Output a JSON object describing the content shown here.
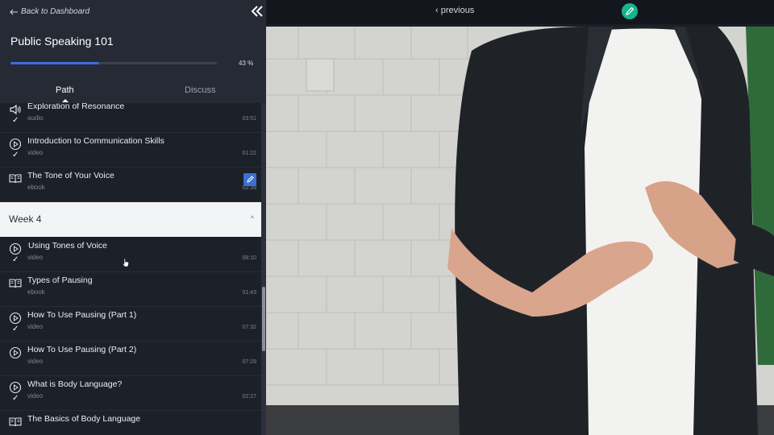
{
  "nav": {
    "back_label": "Back to Dashboard",
    "collapse_icon": "double-chevron-left-icon"
  },
  "course": {
    "title": "Public Speaking 101",
    "progress_percent": 43,
    "progress_text": "43 %"
  },
  "tabs": [
    {
      "label": "Path",
      "active": true
    },
    {
      "label": "Discuss",
      "active": false
    }
  ],
  "lessons_before": [
    {
      "title": "Exploration of Resonance",
      "type": "audio",
      "duration": "03:51",
      "icon": "speaker-icon",
      "completed": true
    },
    {
      "title": "Introduction to Communication Skills",
      "type": "video",
      "duration": "01:22",
      "icon": "play-icon",
      "completed": true
    },
    {
      "title": "The Tone of Your Voice",
      "type": "ebook",
      "duration": "02:39",
      "icon": "book-icon",
      "completed": false,
      "has_edit": true
    }
  ],
  "week": {
    "label": "Week 4",
    "caret": "^"
  },
  "lessons_after": [
    {
      "title": "Using Tones of Voice",
      "type": "video",
      "duration": "08:10",
      "icon": "play-icon",
      "completed": true
    },
    {
      "title": "Types of Pausing",
      "type": "ebook",
      "duration": "01:43",
      "icon": "book-icon",
      "completed": false
    },
    {
      "title": "How To Use Pausing (Part 1)",
      "type": "video",
      "duration": "07:32",
      "icon": "play-icon",
      "completed": true
    },
    {
      "title": "How To Use Pausing (Part 2)",
      "type": "video",
      "duration": "07:29",
      "icon": "play-icon",
      "completed": false
    },
    {
      "title": "What is Body Language?",
      "type": "video",
      "duration": "02:27",
      "icon": "play-icon",
      "completed": true
    },
    {
      "title": "The Basics of Body Language",
      "type": "ebook",
      "duration": "",
      "icon": "book-icon",
      "completed": false
    }
  ],
  "player": {
    "previous_label": "previous",
    "previous_icon": "chevron-left-icon",
    "edit_icon": "pencil-icon"
  },
  "colors": {
    "accent": "#3d6fd6",
    "edit_green": "#17b58c",
    "sidebar_bg": "#252a35",
    "list_bg": "#1c2029",
    "week_header_bg": "#f3f4f6"
  }
}
